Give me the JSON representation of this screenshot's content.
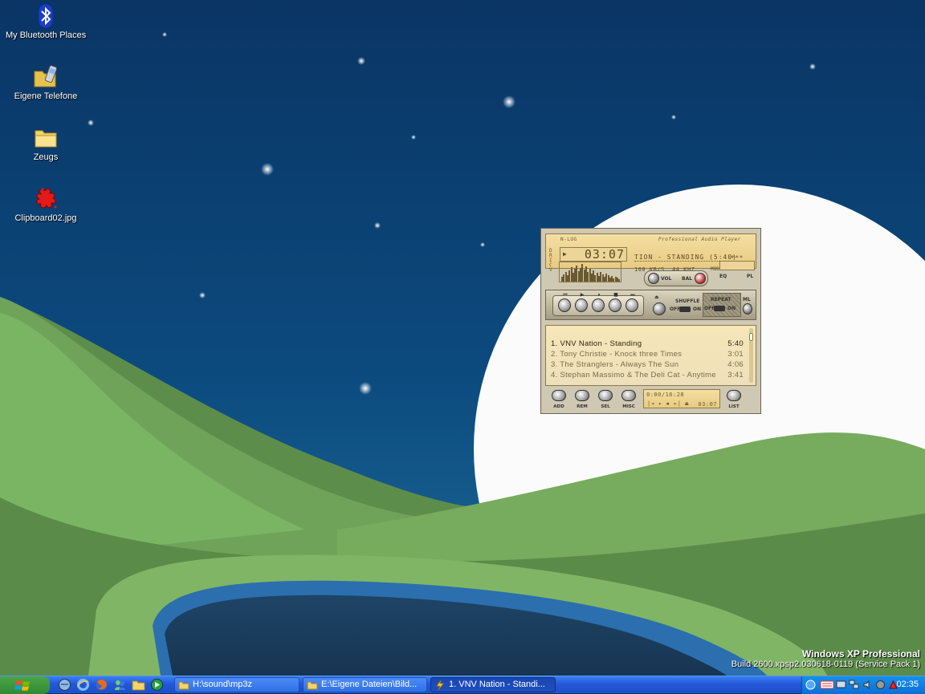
{
  "desktop": {
    "icons": [
      {
        "label": "My Bluetooth Places",
        "icon": "bluetooth-icon"
      },
      {
        "label": "Eigene Telefone",
        "icon": "phone-folder-icon"
      },
      {
        "label": "Zeugs",
        "icon": "folder-icon"
      },
      {
        "label": "Clipboard02.jpg",
        "icon": "image-file-icon"
      }
    ],
    "watermark": {
      "title": "Windows XP Professional",
      "build": "Build 2600.xpsp2.030618-0119 (Service Pack 1)"
    }
  },
  "player": {
    "logo_text": "N-LOG",
    "brand_text": "Professional Audio Player",
    "time": "03:07",
    "track_scroll": "TION - STANDING (5:40)",
    "track_marks": "*** 1.",
    "bitrate": "160 KB/S",
    "samplerate": "44 KHZ",
    "mode_label": "MODE",
    "eq_label": "EQ",
    "pl_label": "PL",
    "vol_label": "VOL",
    "bal_label": "BAL",
    "shuffle_label": "SHUFFLE",
    "repeat_label": "REPEAT",
    "ml_label": "ML",
    "off_label": "OFF",
    "on_label": "ON",
    "playlist": [
      {
        "title": "1. VNV Nation - Standing",
        "duration": "5:40",
        "active": true
      },
      {
        "title": "2. Tony Christie - Knock three Times",
        "duration": "3:01",
        "active": false
      },
      {
        "title": "3. The Stranglers - Always The Sun",
        "duration": "4:06",
        "active": false
      },
      {
        "title": "4. Stephan Massimo & The Deli Cat - Anytime",
        "duration": "3:41",
        "active": false
      }
    ],
    "add_label": "ADD",
    "rem_label": "REM",
    "sel_label": "SEL",
    "misc_label": "MISC",
    "list_label": "LIST",
    "total_time": "0:00/16:28",
    "total_small_time": "03:07"
  },
  "taskbar": {
    "tasks": [
      {
        "label": "H:\\sound\\mp3z",
        "icon": "folder-icon"
      },
      {
        "label": "E:\\Eigene Dateien\\Bild...",
        "icon": "folder-icon"
      },
      {
        "label": "1. VNV Nation - Standi...",
        "icon": "lightning-icon",
        "active": true
      }
    ],
    "clock": "02:35"
  },
  "colors": {
    "sky": "#0b3a6b",
    "hill_green": "#6fa35a",
    "moon": "#ffffff",
    "taskbar_blue": "#245edb",
    "player_gold": "#f0d898"
  }
}
